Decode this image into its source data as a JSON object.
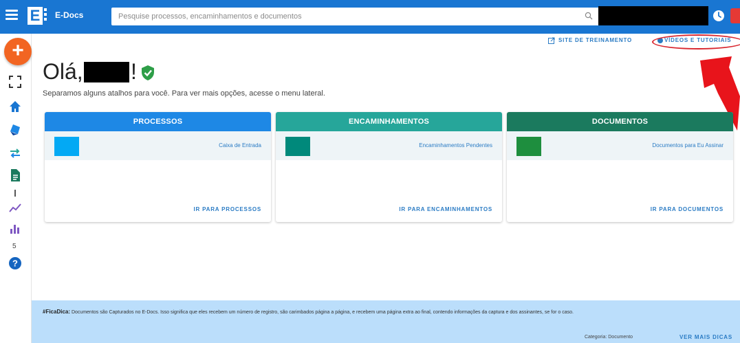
{
  "app": {
    "name": "E-Docs",
    "logo_letter": "E"
  },
  "search": {
    "placeholder": "Pesquise processos, encaminhamentos e documentos"
  },
  "links": {
    "training": "SITE DE TREINAMENTO",
    "videos": "VÍDEOS E TUTORIAIS"
  },
  "fab": {
    "label": "+"
  },
  "rail": {
    "num_a": "I",
    "num_b": "5"
  },
  "greeting": {
    "hello": "Olá,",
    "suffix": "!",
    "subtitle": "Separamos alguns atalhos para você. Para ver mais opções, acesse o menu lateral."
  },
  "cards": [
    {
      "title": "PROCESSOS",
      "row_label": "Caixa de Entrada",
      "link": "IR PARA PROCESSOS",
      "header_color": "#1e88e5",
      "swatch_color": "#03a9f4"
    },
    {
      "title": "ENCAMINHAMENTOS",
      "row_label": "Encaminhamentos Pendentes",
      "link": "IR PARA ENCAMINHAMENTOS",
      "header_color": "#26a69a",
      "swatch_color": "#00897b"
    },
    {
      "title": "DOCUMENTOS",
      "row_label": "Documentos para Eu Assinar",
      "link": "IR PARA DOCUMENTOS",
      "header_color": "#1b7a5e",
      "swatch_color": "#1e8e3e"
    }
  ],
  "tip": {
    "label": "#FicaDica:",
    "text": "Documentos são Capturados no E-Docs. Isso significa que eles recebem um número de registro, são carimbados página a página, e recebem uma página extra ao final, contendo informações da captura e dos assinantes, se for o caso.",
    "category": "Categoria: Documento",
    "more": "VER MAIS DICAS"
  }
}
